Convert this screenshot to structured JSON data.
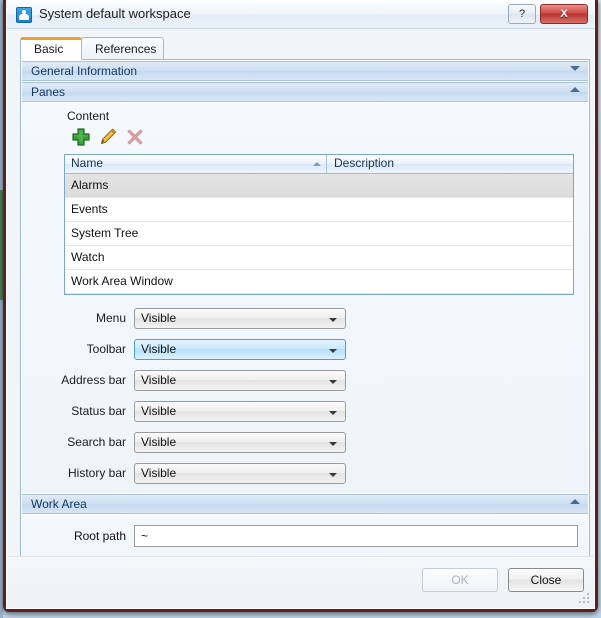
{
  "window": {
    "title": "System default workspace",
    "icon": "workspace-icon",
    "help_label": "?",
    "close_label": "X"
  },
  "tabs": [
    {
      "label": "Basic",
      "active": true
    },
    {
      "label": "References",
      "active": false
    }
  ],
  "sections": {
    "general": {
      "label": "General Information",
      "expanded": false,
      "chevron": "chevron-down-icon"
    },
    "panes": {
      "label": "Panes",
      "expanded": true,
      "chevron": "chevron-up-icon"
    },
    "work_area": {
      "label": "Work Area",
      "expanded": true,
      "chevron": "chevron-up-icon"
    }
  },
  "panes": {
    "content_label": "Content",
    "toolbar": [
      {
        "name": "add-icon",
        "tooltip": "Add",
        "enabled": true
      },
      {
        "name": "edit-icon",
        "tooltip": "Edit",
        "enabled": true
      },
      {
        "name": "delete-icon",
        "tooltip": "Delete",
        "enabled": false
      }
    ],
    "table": {
      "columns": [
        "Name",
        "Description"
      ],
      "sort_column": "Name",
      "sort_direction": "ascending",
      "rows": [
        {
          "name": "Alarms",
          "description": "",
          "selected": true
        },
        {
          "name": "Events",
          "description": "",
          "selected": false
        },
        {
          "name": "System Tree",
          "description": "",
          "selected": false
        },
        {
          "name": "Watch",
          "description": "",
          "selected": false
        },
        {
          "name": "Work Area Window",
          "description": "",
          "selected": false
        }
      ]
    },
    "options": [
      {
        "label": "Menu",
        "value": "Visible",
        "focused": false
      },
      {
        "label": "Toolbar",
        "value": "Visible",
        "focused": true
      },
      {
        "label": "Address bar",
        "value": "Visible",
        "focused": false
      },
      {
        "label": "Status bar",
        "value": "Visible",
        "focused": false
      },
      {
        "label": "Search bar",
        "value": "Visible",
        "focused": false
      },
      {
        "label": "History bar",
        "value": "Visible",
        "focused": false
      }
    ]
  },
  "work_area": {
    "root_path_label": "Root path",
    "root_path_value": "~"
  },
  "footer": {
    "ok_label": "OK",
    "ok_enabled": false,
    "close_label": "Close",
    "close_enabled": true
  },
  "colors": {
    "accent_tab": "#f0a030",
    "section_header": "#cfe0f2",
    "close_button": "#b83631",
    "frame_border": "#5d1f22",
    "focus_blue": "#4f9fd4"
  }
}
